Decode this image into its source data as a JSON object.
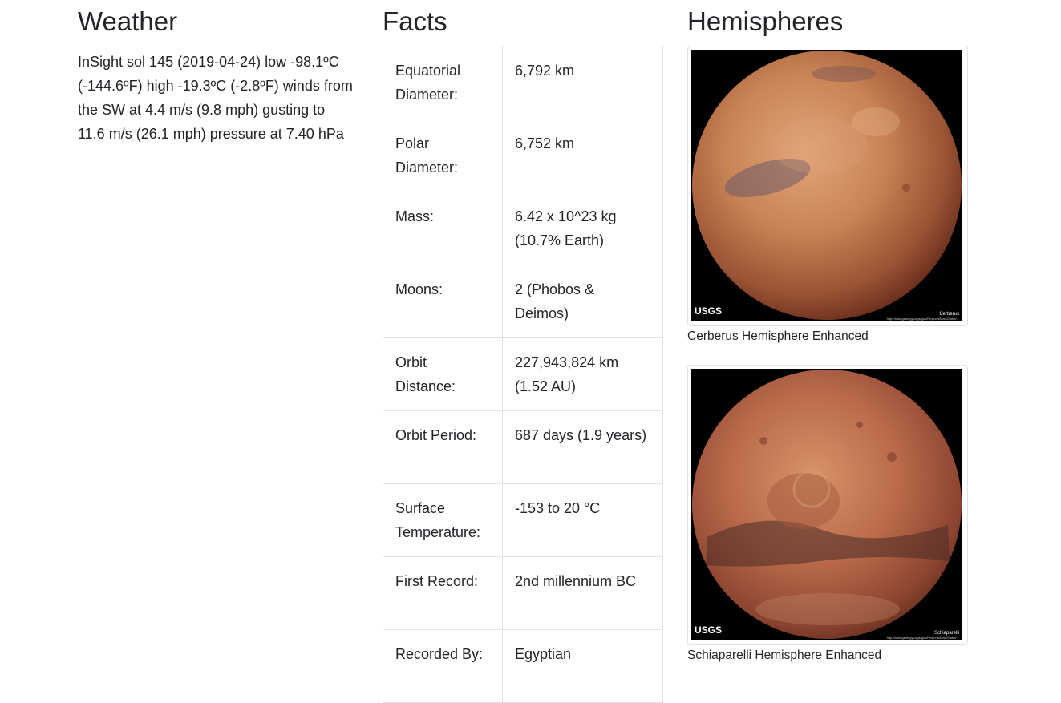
{
  "weather": {
    "heading": "Weather",
    "text": "InSight sol 145 (2019-04-24) low -98.1ºC (-144.6ºF) high -19.3ºC (-2.8ºF) winds from the SW at 4.4 m/s (9.8 mph) gusting to 11.6 m/s (26.1 mph) pressure at 7.40 hPa"
  },
  "facts": {
    "heading": "Facts",
    "rows": [
      {
        "label": "Equatorial Diameter:",
        "value": "6,792 km"
      },
      {
        "label": "Polar Diameter:",
        "value": "6,752 km"
      },
      {
        "label": "Mass:",
        "value": "6.42 x 10^23 kg (10.7% Earth)"
      },
      {
        "label": "Moons:",
        "value": "2 (Phobos & Deimos)"
      },
      {
        "label": "Orbit Distance:",
        "value": "227,943,824 km (1.52 AU)"
      },
      {
        "label": "Orbit Period:",
        "value": "687 days (1.9 years)"
      },
      {
        "label": "Surface Temperature:",
        "value": "-153 to 20 °C"
      },
      {
        "label": "First Record:",
        "value": "2nd millennium BC"
      },
      {
        "label": "Recorded By:",
        "value": "Egyptian"
      }
    ]
  },
  "hemispheres": {
    "heading": "Hemispheres",
    "items": [
      {
        "title": "Cerberus Hemisphere Enhanced",
        "image_logo": "USGS",
        "image_label": "Cerberus",
        "image_url_text": "http://astrogeology.usgs.gov/Projects/MarsGlobe/..."
      },
      {
        "title": "Schiaparelli Hemisphere Enhanced",
        "image_logo": "USGS",
        "image_label": "Schiaparelli",
        "image_url_text": "http://astrogeology.usgs.gov/Projects/MarsGlobe/..."
      }
    ]
  },
  "colors": {
    "text": "#212529",
    "border": "#dee2e6",
    "mars_light": "#d08a5e",
    "mars_dark": "#7a3a22"
  }
}
